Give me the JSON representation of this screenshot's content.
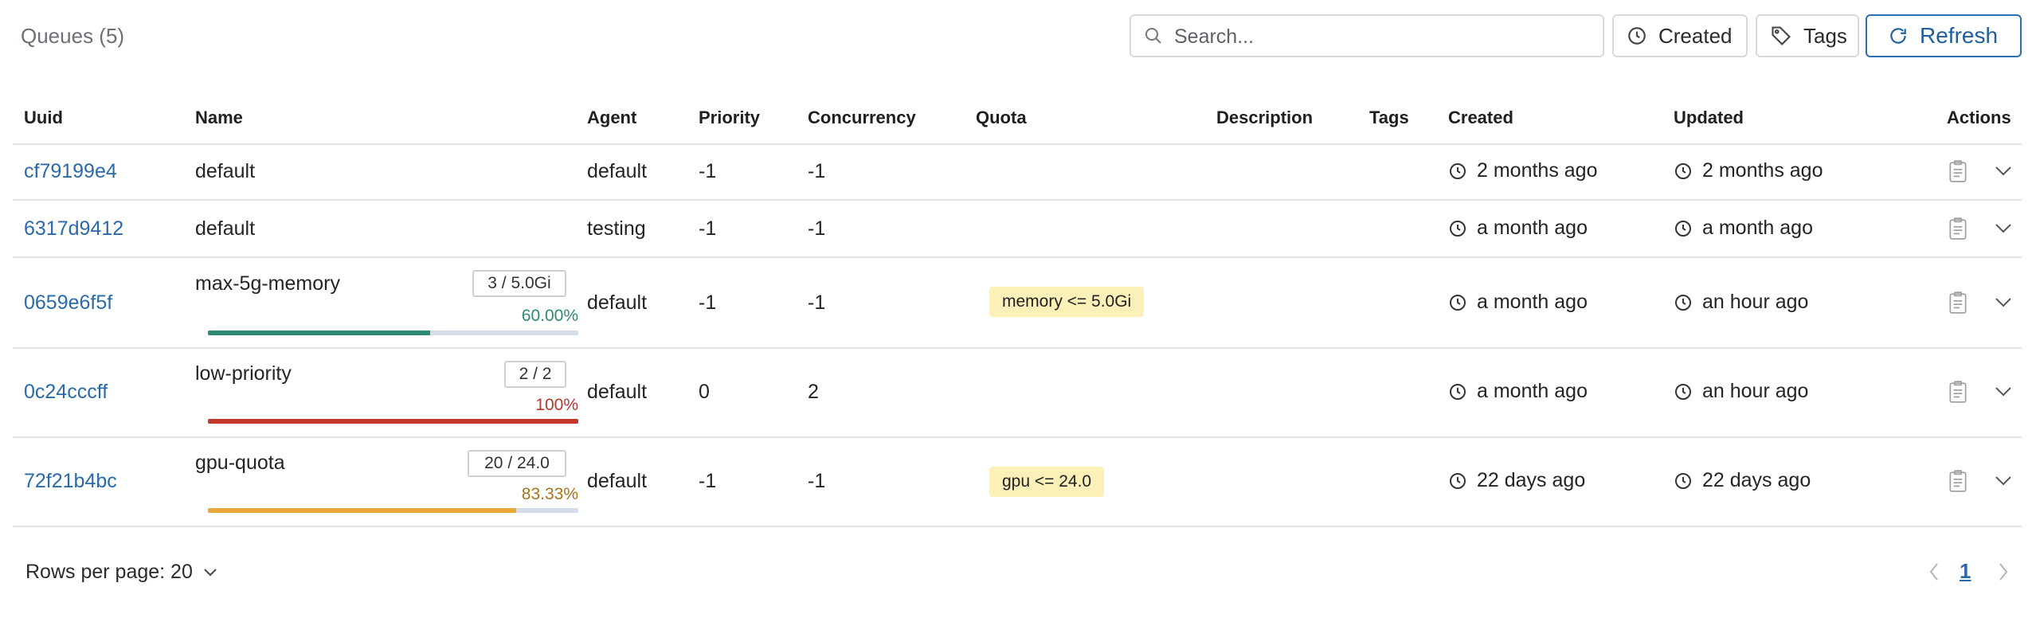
{
  "toolbar": {
    "title": "Queues (5)",
    "search_placeholder": "Search...",
    "created_label": "Created",
    "tags_label": "Tags",
    "refresh_label": "Refresh"
  },
  "columns": [
    "Uuid",
    "Name",
    "Agent",
    "Priority",
    "Concurrency",
    "Quota",
    "Description",
    "Tags",
    "Created",
    "Updated",
    "Actions"
  ],
  "rows": [
    {
      "uuid": "cf79199e4",
      "name": "default",
      "agent": "default",
      "priority": "-1",
      "concurrency": "-1",
      "quota_tag": "",
      "created": "2 months ago",
      "updated": "2 months ago"
    },
    {
      "uuid": "6317d9412",
      "name": "default",
      "agent": "testing",
      "priority": "-1",
      "concurrency": "-1",
      "quota_tag": "",
      "created": "a month ago",
      "updated": "a month ago"
    },
    {
      "uuid": "0659e6f5f",
      "name": "max-5g-memory",
      "usage_badge": "3 / 5.0Gi",
      "usage_percent": "60.00%",
      "usage_fraction": 0.6,
      "usage_color": "#2e8b72",
      "agent": "default",
      "priority": "-1",
      "concurrency": "-1",
      "quota_tag": "memory <= 5.0Gi",
      "created": "a month ago",
      "updated": "an hour ago"
    },
    {
      "uuid": "0c24cccff",
      "name": "low-priority",
      "usage_badge": "2 / 2",
      "usage_percent": "100%",
      "usage_fraction": 1.0,
      "usage_color": "#c0392b",
      "agent": "default",
      "priority": "0",
      "concurrency": "2",
      "quota_tag": "",
      "created": "a month ago",
      "updated": "an hour ago"
    },
    {
      "uuid": "72f21b4bc",
      "name": "gpu-quota",
      "usage_badge": "20 / 24.0",
      "usage_percent": "83.33%",
      "usage_fraction": 0.8333,
      "usage_color": "#e9a83a",
      "usage_text_color": "#a8741a",
      "agent": "default",
      "priority": "-1",
      "concurrency": "-1",
      "quota_tag": "gpu <= 24.0",
      "created": "22 days ago",
      "updated": "22 days ago"
    }
  ],
  "footer": {
    "rows_per_page_label": "Rows per page: 20",
    "current_page": "1"
  },
  "colors": {
    "accent": "#2a6aaa",
    "quota_tag_bg": "#fbf0b8",
    "border": "#e4e4e4"
  },
  "icons": {
    "search": "search-icon",
    "clock": "clock-icon",
    "tag": "tag-icon",
    "refresh": "refresh-icon",
    "copy": "clipboard-icon",
    "expand": "chevron-down-icon"
  }
}
